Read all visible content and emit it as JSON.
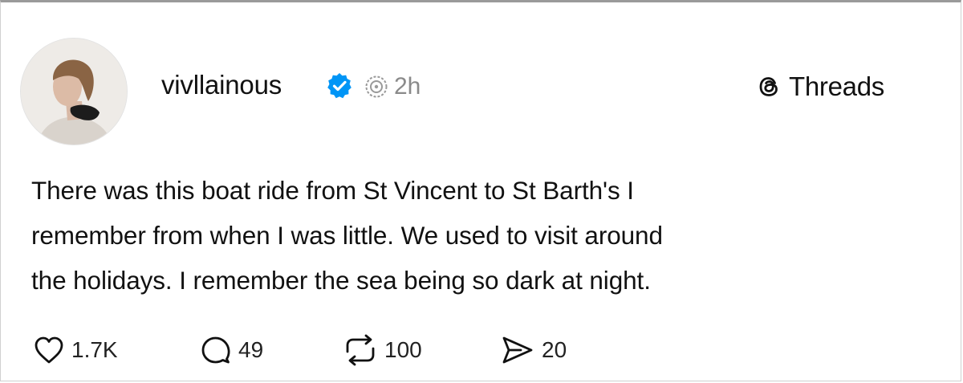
{
  "post": {
    "username": "vivllainous",
    "timestamp": "2h",
    "brand": "Threads",
    "text_lines": [
      "There was this boat ride from St Vincent to St Barth's I",
      "remember from when I was little. We used to visit around",
      "the holidays. I remember the sea being so dark at night."
    ],
    "stats": {
      "likes": "1.7K",
      "replies": "49",
      "reposts": "100",
      "shares": "20"
    }
  },
  "icons": {
    "avatar": "profile-photo",
    "verified": "verified-badge-icon",
    "thread": "thread-icon",
    "brand": "threads-logo-icon",
    "like": "heart-icon",
    "reply": "comment-icon",
    "repost": "repost-icon",
    "share": "send-icon"
  },
  "colors": {
    "verified_blue": "#0095f6",
    "text": "#111111",
    "muted": "#8a8a8a"
  }
}
